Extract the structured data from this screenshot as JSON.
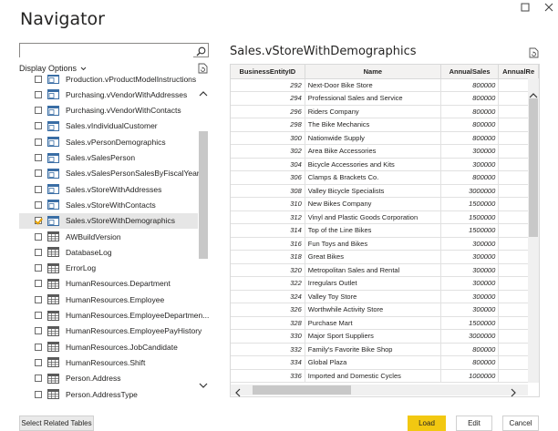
{
  "window": {
    "title": "Navigator"
  },
  "left": {
    "search_value": "",
    "display_options_label": "Display Options",
    "items": [
      {
        "label": "Production.vProductModelInstructions",
        "type": "view",
        "checked": false
      },
      {
        "label": "Purchasing.vVendorWithAddresses",
        "type": "view",
        "checked": false
      },
      {
        "label": "Purchasing.vVendorWithContacts",
        "type": "view",
        "checked": false
      },
      {
        "label": "Sales.vIndividualCustomer",
        "type": "view",
        "checked": false
      },
      {
        "label": "Sales.vPersonDemographics",
        "type": "view",
        "checked": false
      },
      {
        "label": "Sales.vSalesPerson",
        "type": "view",
        "checked": false
      },
      {
        "label": "Sales.vSalesPersonSalesByFiscalYears",
        "type": "view",
        "checked": false
      },
      {
        "label": "Sales.vStoreWithAddresses",
        "type": "view",
        "checked": false
      },
      {
        "label": "Sales.vStoreWithContacts",
        "type": "view",
        "checked": false
      },
      {
        "label": "Sales.vStoreWithDemographics",
        "type": "view",
        "checked": true
      },
      {
        "label": "AWBuildVersion",
        "type": "table",
        "checked": false
      },
      {
        "label": "DatabaseLog",
        "type": "table",
        "checked": false
      },
      {
        "label": "ErrorLog",
        "type": "table",
        "checked": false
      },
      {
        "label": "HumanResources.Department",
        "type": "table",
        "checked": false
      },
      {
        "label": "HumanResources.Employee",
        "type": "table",
        "checked": false
      },
      {
        "label": "HumanResources.EmployeeDepartmen...",
        "type": "table",
        "checked": false
      },
      {
        "label": "HumanResources.EmployeePayHistory",
        "type": "table",
        "checked": false
      },
      {
        "label": "HumanResources.JobCandidate",
        "type": "table",
        "checked": false
      },
      {
        "label": "HumanResources.Shift",
        "type": "table",
        "checked": false
      },
      {
        "label": "Person.Address",
        "type": "table",
        "checked": false
      },
      {
        "label": "Person.AddressType",
        "type": "table",
        "checked": false
      }
    ]
  },
  "preview": {
    "title": "Sales.vStoreWithDemographics",
    "columns": [
      "BusinessEntityID",
      "Name",
      "AnnualSales",
      "AnnualRe"
    ],
    "rows": [
      [
        "292",
        "Next-Door Bike Store",
        "800000"
      ],
      [
        "294",
        "Professional Sales and Service",
        "800000"
      ],
      [
        "296",
        "Riders Company",
        "800000"
      ],
      [
        "298",
        "The Bike Mechanics",
        "800000"
      ],
      [
        "300",
        "Nationwide Supply",
        "800000"
      ],
      [
        "302",
        "Area Bike Accessories",
        "300000"
      ],
      [
        "304",
        "Bicycle Accessories and Kits",
        "300000"
      ],
      [
        "306",
        "Clamps & Brackets Co.",
        "800000"
      ],
      [
        "308",
        "Valley Bicycle Specialists",
        "3000000"
      ],
      [
        "310",
        "New Bikes Company",
        "1500000"
      ],
      [
        "312",
        "Vinyl and Plastic Goods Corporation",
        "1500000"
      ],
      [
        "314",
        "Top of the Line Bikes",
        "1500000"
      ],
      [
        "316",
        "Fun Toys and Bikes",
        "300000"
      ],
      [
        "318",
        "Great Bikes",
        "300000"
      ],
      [
        "320",
        "Metropolitan Sales and Rental",
        "300000"
      ],
      [
        "322",
        "Irregulars Outlet",
        "300000"
      ],
      [
        "324",
        "Valley Toy Store",
        "300000"
      ],
      [
        "326",
        "Worthwhile Activity Store",
        "300000"
      ],
      [
        "328",
        "Purchase Mart",
        "1500000"
      ],
      [
        "330",
        "Major Sport Suppliers",
        "3000000"
      ],
      [
        "332",
        "Family's Favorite Bike Shop",
        "800000"
      ],
      [
        "334",
        "Global Plaza",
        "800000"
      ],
      [
        "336",
        "Imported and Domestic Cycles",
        "1000000"
      ]
    ]
  },
  "footer": {
    "select_related_label": "Select Related Tables",
    "load_label": "Load",
    "edit_label": "Edit",
    "cancel_label": "Cancel"
  },
  "colors": {
    "accent": "#f2c811",
    "checkmark": "#e8a200",
    "view_icon": "#3a6ea5",
    "table_icon": "#5b5b5b"
  }
}
